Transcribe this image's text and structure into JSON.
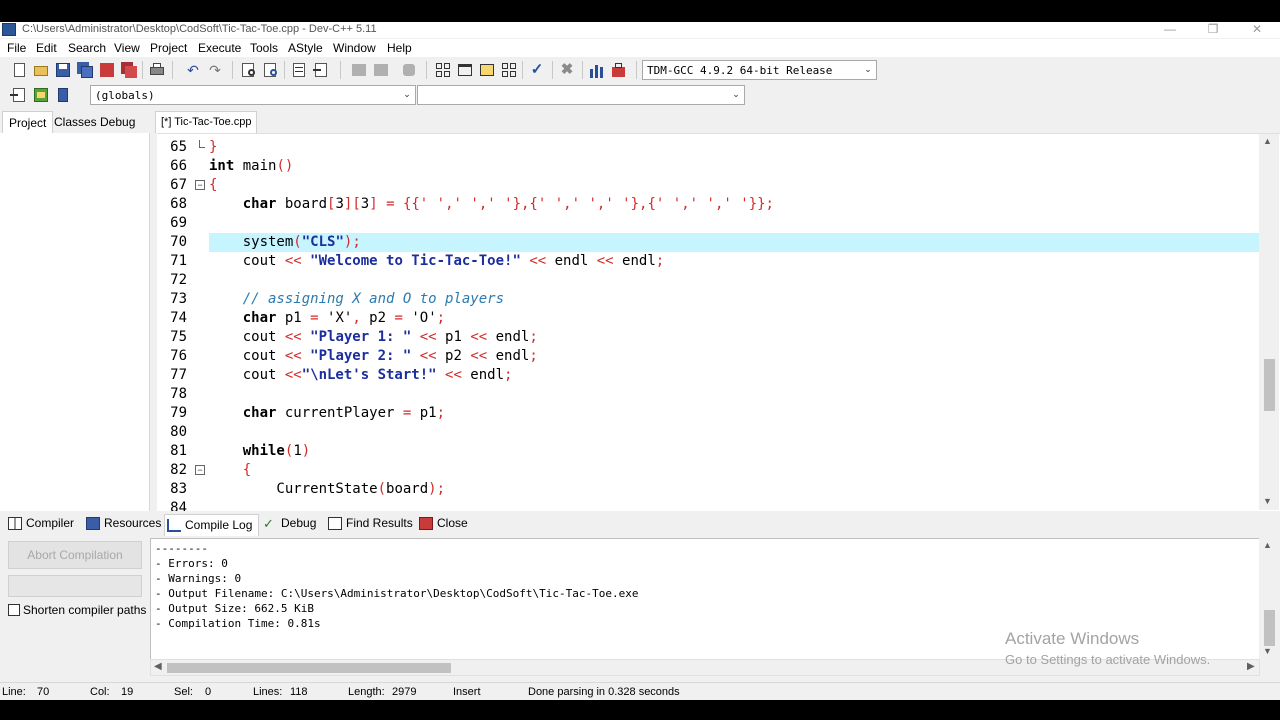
{
  "window": {
    "title": "C:\\Users\\Administrator\\Desktop\\CodSoft\\Tic-Tac-Toe.cpp - Dev-C++ 5.11"
  },
  "menu": [
    "File",
    "Edit",
    "Search",
    "View",
    "Project",
    "Execute",
    "Tools",
    "AStyle",
    "Window",
    "Help"
  ],
  "toolbar": {
    "compiler_select": "TDM-GCC 4.9.2 64-bit Release",
    "scope_select": "(globals)",
    "member_select": ""
  },
  "left_tabs": [
    "Project",
    "Classes",
    "Debug"
  ],
  "editor": {
    "file_tab": "[*] Tic-Tac-Toe.cpp",
    "current_line": 70,
    "line_numbers": [
      "65",
      "66",
      "67",
      "68",
      "69",
      "70",
      "71",
      "72",
      "73",
      "74",
      "75",
      "76",
      "77",
      "78",
      "79",
      "80",
      "81",
      "82",
      "83",
      "84"
    ]
  },
  "bottom_tabs": {
    "compiler": "Compiler",
    "resources": "Resources",
    "compile_log": "Compile Log",
    "debug": "Debug",
    "find_results": "Find Results",
    "close": "Close"
  },
  "compile_panel": {
    "abort_label": "Abort Compilation",
    "shorten_label": "Shorten compiler paths",
    "log_lines": [
      "--------",
      "- Errors: 0",
      "- Warnings: 0",
      "- Output Filename: C:\\Users\\Administrator\\Desktop\\CodSoft\\Tic-Tac-Toe.exe",
      "- Output Size: 662.5 KiB",
      "- Compilation Time: 0.81s"
    ]
  },
  "watermark": {
    "line1": "Activate Windows",
    "line2": "Go to Settings to activate Windows."
  },
  "status": {
    "line_label": "Line:",
    "line_value": "70",
    "col_label": "Col:",
    "col_value": "19",
    "sel_label": "Sel:",
    "sel_value": "0",
    "lines_label": "Lines:",
    "lines_value": "118",
    "length_label": "Length:",
    "length_value": "2979",
    "mode": "Insert",
    "message": "Done parsing in 0.328 seconds"
  },
  "colors": {
    "current_line_highlight": "#c6f4ff",
    "string_color": "#1c2d9e",
    "symbol_color": "#d22a2a",
    "comment_color": "#2c7ab0"
  }
}
